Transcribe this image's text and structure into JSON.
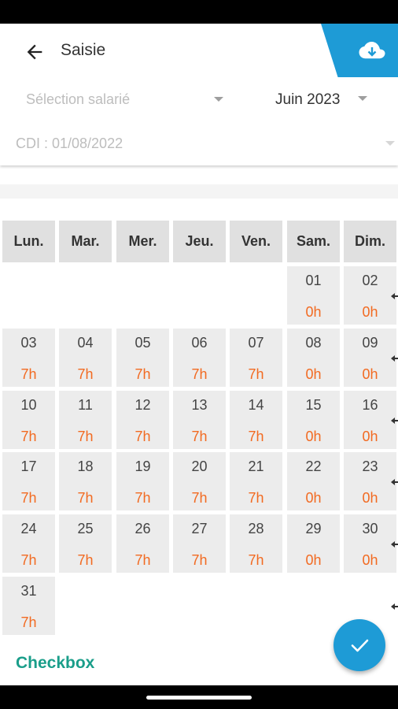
{
  "header": {
    "title": "Saisie",
    "employee_placeholder": "Sélection salarié",
    "month": "Juin 2023",
    "contract": "CDI : 01/08/2022"
  },
  "calendar": {
    "weekdays": [
      "Lun.",
      "Mar.",
      "Mer.",
      "Jeu.",
      "Ven.",
      "Sam.",
      "Dim."
    ],
    "weeks": [
      [
        null,
        null,
        null,
        null,
        null,
        {
          "day": "01",
          "hours": "0h"
        },
        {
          "day": "02",
          "hours": "0h"
        }
      ],
      [
        {
          "day": "03",
          "hours": "7h"
        },
        {
          "day": "04",
          "hours": "7h"
        },
        {
          "day": "05",
          "hours": "7h"
        },
        {
          "day": "06",
          "hours": "7h"
        },
        {
          "day": "07",
          "hours": "7h"
        },
        {
          "day": "08",
          "hours": "0h"
        },
        {
          "day": "09",
          "hours": "0h"
        }
      ],
      [
        {
          "day": "10",
          "hours": "7h"
        },
        {
          "day": "11",
          "hours": "7h"
        },
        {
          "day": "12",
          "hours": "7h"
        },
        {
          "day": "13",
          "hours": "7h"
        },
        {
          "day": "14",
          "hours": "7h"
        },
        {
          "day": "15",
          "hours": "0h"
        },
        {
          "day": "16",
          "hours": "0h"
        }
      ],
      [
        {
          "day": "17",
          "hours": "7h"
        },
        {
          "day": "18",
          "hours": "7h"
        },
        {
          "day": "19",
          "hours": "7h"
        },
        {
          "day": "20",
          "hours": "7h"
        },
        {
          "day": "21",
          "hours": "7h"
        },
        {
          "day": "22",
          "hours": "0h"
        },
        {
          "day": "23",
          "hours": "0h"
        }
      ],
      [
        {
          "day": "24",
          "hours": "7h"
        },
        {
          "day": "25",
          "hours": "7h"
        },
        {
          "day": "26",
          "hours": "7h"
        },
        {
          "day": "27",
          "hours": "7h"
        },
        {
          "day": "28",
          "hours": "7h"
        },
        {
          "day": "29",
          "hours": "0h"
        },
        {
          "day": "30",
          "hours": "0h"
        }
      ],
      [
        {
          "day": "31",
          "hours": "7h"
        },
        null,
        null,
        null,
        null,
        null,
        null
      ]
    ]
  },
  "footer": {
    "checkbox_label": "Checkbox"
  },
  "colors": {
    "accent": "#1e9bd6",
    "hours": "#f26a21",
    "link": "#1a9e8a"
  }
}
